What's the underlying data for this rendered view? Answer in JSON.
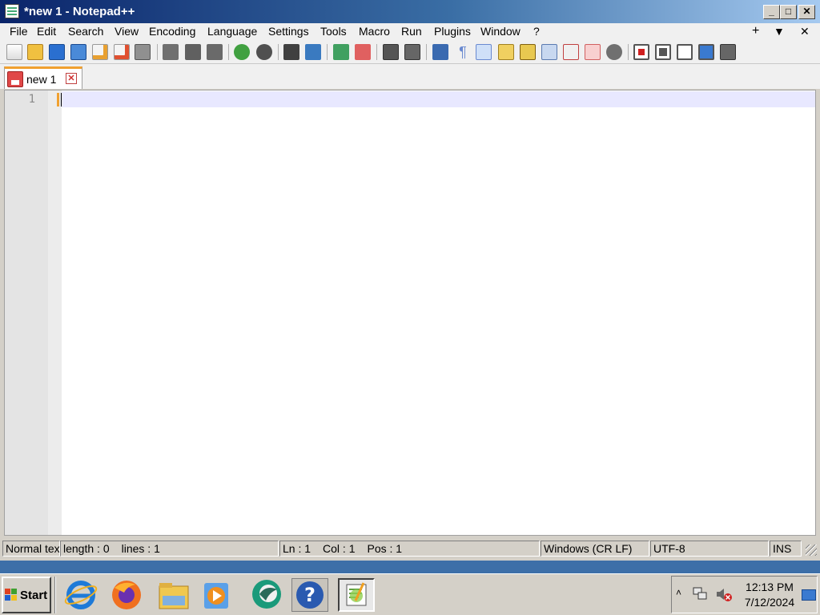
{
  "window": {
    "title": "*new 1 - Notepad++",
    "buttons": {
      "minimize": "_",
      "maximize": "□",
      "close": "✕"
    }
  },
  "menubar": {
    "items": [
      "File",
      "Edit",
      "Search",
      "View",
      "Encoding",
      "Language",
      "Settings",
      "Tools",
      "Macro",
      "Run",
      "Plugins",
      "Window",
      "?"
    ],
    "right": {
      "add": "+",
      "dropdown": "▼",
      "close": "✕"
    }
  },
  "toolbar": {
    "buttons": [
      "new-file-icon",
      "open-file-icon",
      "save-icon",
      "save-all-icon",
      "close-icon",
      "close-all-icon",
      "print-icon",
      "cut-icon",
      "copy-icon",
      "paste-icon",
      "undo-icon",
      "redo-icon",
      "find-icon",
      "replace-icon",
      "zoom-in-icon",
      "zoom-out-icon",
      "sync-vertical-icon",
      "sync-horizontal-icon",
      "word-wrap-icon",
      "show-all-chars-icon",
      "indent-guide-icon",
      "udl-icon",
      "doc-map-icon",
      "doc-list-icon",
      "function-list-icon",
      "folder-as-workspace-icon",
      "monitoring-icon",
      "record-macro-icon",
      "stop-record-icon",
      "playback-icon",
      "run-macro-multiple-icon",
      "save-macro-icon"
    ]
  },
  "tabs": [
    {
      "label": "new 1",
      "close": "✕",
      "modified": true
    }
  ],
  "editor": {
    "line_numbers": [
      "1"
    ],
    "content": ""
  },
  "statusbar": {
    "file_type": "Normal tex",
    "length": "length : 0",
    "lines": "lines : 1",
    "ln": "Ln : 1",
    "col": "Col : 1",
    "pos": "Pos : 1",
    "eol": "Windows (CR LF)",
    "encoding": "UTF-8",
    "mode": "INS"
  },
  "taskbar": {
    "start_label": "Start",
    "apps": [
      "internet-explorer-icon",
      "firefox-icon",
      "file-explorer-icon",
      "media-player-icon",
      "chat-app-icon",
      "help-icon",
      "notepadpp-icon"
    ],
    "tray": {
      "time": "12:13 PM",
      "date": "7/12/2024"
    }
  },
  "colors": {
    "title_start": "#0a246a",
    "title_end": "#a6caf0",
    "tab_accent": "#f0a030",
    "current_line": "#e8e8ff",
    "taskbar_strip": "#3d6fa8"
  }
}
